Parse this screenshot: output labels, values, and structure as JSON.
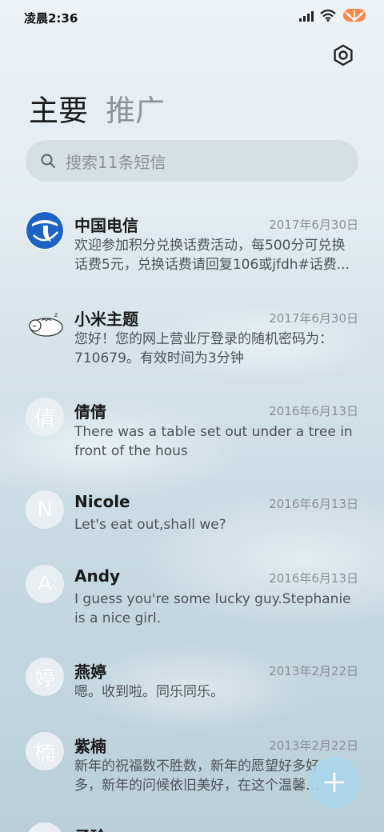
{
  "status_bar": {
    "time": "凌晨2:36",
    "icons": [
      "signal-icon",
      "wifi-icon",
      "battery-icon"
    ]
  },
  "header": {
    "tabs": [
      {
        "label": "主要",
        "active": true
      },
      {
        "label": "推广",
        "active": false
      }
    ],
    "settings_icon": "settings-icon"
  },
  "search": {
    "placeholder": "搜索11条短信"
  },
  "conversations": [
    {
      "name": "中国电信",
      "date": "2017年6月30日",
      "preview": "欢迎参加积分兑换话费活动，每500分可兑换话费5元，兑换话费请回复106或jfdh#话费...",
      "avatar": "china-telecom-logo-icon"
    },
    {
      "name": "小米主题",
      "date": "2017年6月30日",
      "preview": "您好！您的网上营业厅登录的随机密码为：710679。有效时间为3分钟",
      "avatar": "sleeping-sheep-icon"
    },
    {
      "name": "倩倩",
      "date": "2016年6月13日",
      "preview": "There was a table set out under a tree in front of the hous",
      "avatar_letter": "倩"
    },
    {
      "name": "Nicole",
      "date": "2016年6月13日",
      "preview": "Let's eat out,shall we?",
      "avatar_letter": "N"
    },
    {
      "name": "Andy",
      "date": "2016年6月13日",
      "preview": "I guess you're some lucky guy.Stephanie is a nice girl.",
      "avatar_letter": "A"
    },
    {
      "name": "燕婷",
      "date": "2013年2月22日",
      "preview": "嗯。收到啦。同乐同乐。",
      "avatar_letter": "婷"
    },
    {
      "name": "紫楠",
      "date": "2013年2月22日",
      "preview": "新年的祝福数不胜数，新年的愿望好多好多，新年的问候依旧美好，在这个温馨的时刻",
      "avatar_letter": "楠"
    },
    {
      "name": "子玲",
      "date": "",
      "preview": "",
      "avatar_letter": ""
    }
  ],
  "fab": {
    "icon": "plus-icon"
  },
  "colors": {
    "date": "#8b9196",
    "fab": "#aad6ec",
    "telecom_blue": "#1e63c4"
  }
}
